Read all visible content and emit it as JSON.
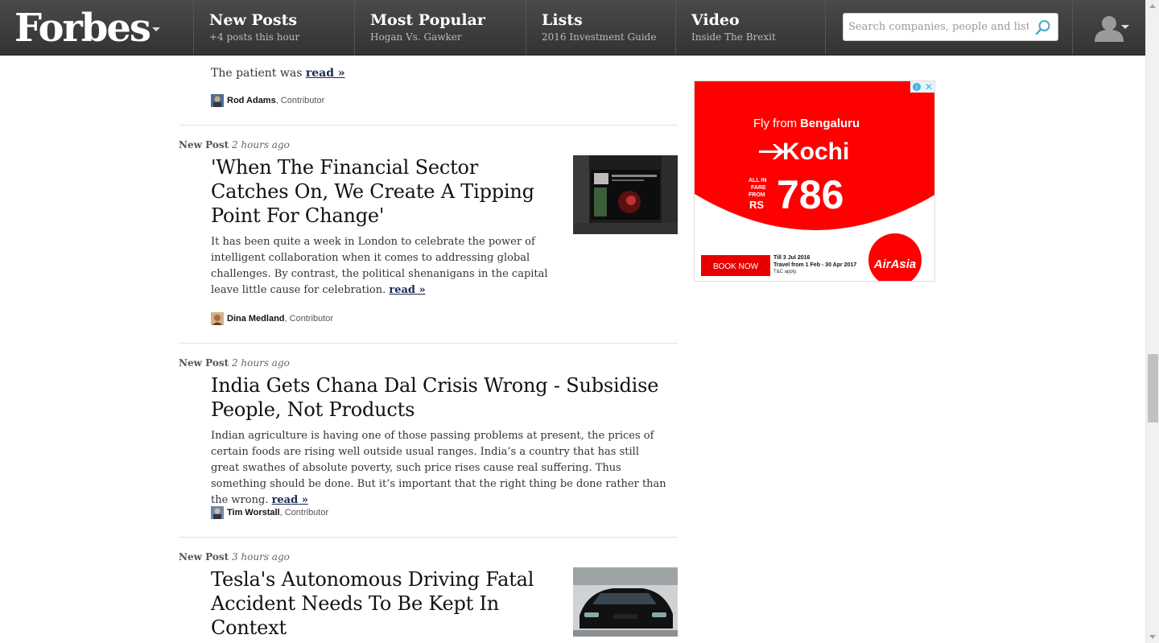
{
  "nav": {
    "logo": "Forbes",
    "items": [
      {
        "title": "New Posts",
        "sub": "+4 posts this hour"
      },
      {
        "title": "Most Popular",
        "sub": "Hogan Vs. Gawker"
      },
      {
        "title": "Lists",
        "sub": "2016 Investment Guide"
      },
      {
        "title": "Video",
        "sub": "Inside The Brexit"
      }
    ],
    "search_placeholder": "Search companies, people and lists"
  },
  "feed": {
    "prev": {
      "excerpt": "The patient was",
      "read": "read »",
      "author": "Rod Adams",
      "role": ", Contributor"
    },
    "posts": [
      {
        "kind": "New Post",
        "time": "2 hours ago",
        "headline": "'When The Financial Sector Catches On, We Create A Tipping Point For Change'",
        "excerpt": "It has been quite a week in London to celebrate the power of intelligent collaboration when it comes to addressing global challenges. By contrast, the political shenanigans in the capital leave little cause for celebration.",
        "read": "read »",
        "author": "Dina Medland",
        "role": ", Contributor"
      },
      {
        "kind": "New Post",
        "time": "2 hours ago",
        "headline": "India Gets Chana Dal Crisis Wrong - Subsidise People, Not Products",
        "excerpt": "Indian agriculture is having one of those passing problems at present, the prices of certain foods are rising well outside usual ranges. India’s a country that has still great swathes of absolute poverty, such price rises cause real suffering. Thus something should be done. But it’s important that the right thing be done rather than the wrong.",
        "read": "read »",
        "author": "Tim Worstall",
        "role": ", Contributor"
      },
      {
        "kind": "New Post",
        "time": "3 hours ago",
        "headline": "Tesla's Autonomous Driving Fatal Accident Needs To Be Kept In Context"
      }
    ]
  },
  "ad": {
    "from": "Fly from",
    "origin": "Bengaluru",
    "destination": "Kochi",
    "fare_note_1": "ALL IN",
    "fare_note_2": "FARE",
    "fare_note_3": "FROM",
    "currency": "RS",
    "price": "786",
    "cta": "BOOK NOW",
    "terms_1": "Till 3 Jul 2016",
    "terms_2": "Travel from 1 Feb - 30 Apr 2017",
    "terms_3": "T&C apply.",
    "brand": "AirAsia",
    "brand_color": "#ff0000"
  }
}
